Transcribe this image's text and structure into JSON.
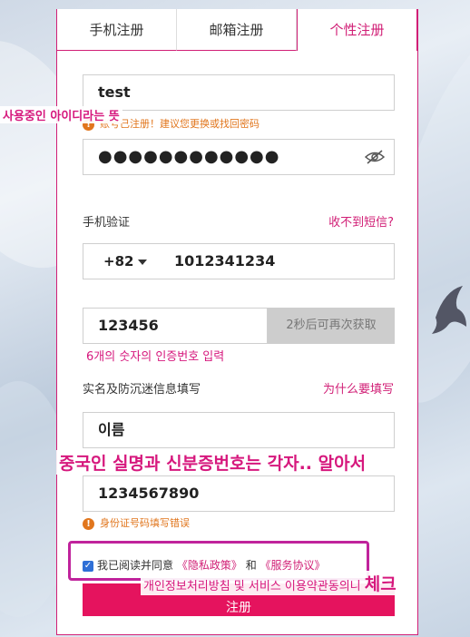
{
  "tabs": [
    {
      "label": "手机注册",
      "active": false
    },
    {
      "label": "邮箱注册",
      "active": false
    },
    {
      "label": "个性注册",
      "active": true
    }
  ],
  "form": {
    "account_value": "test",
    "account_error": "账号已注册！建议您更换或找回密码",
    "password_mask": "●●●●●●●●●●●●",
    "phone_label": "手机验证",
    "no_sms_link": "收不到短信?",
    "country_code": "+82",
    "phone_value": "1012341234",
    "code_value": "123456",
    "code_button": "2秒后可再次获取",
    "realname_label": "实名及防沉迷信息填写",
    "why_link": "为什么要填写",
    "name_value": "이름",
    "idno_value": "1234567890",
    "idno_error": "身份证号码填写错误",
    "agree_prefix": "我已阅读并同意",
    "privacy_link": "《隐私政策》",
    "and_text": "和",
    "service_link": "《服务协议》",
    "submit_label": "注册"
  },
  "annotations": {
    "id_note": "사용중인 아이디라는 뜻",
    "code_note": "6개의 숫자의 인증번호 입력",
    "realname_note": "중국인 실명과 신분증번호는 각자.. 알아서",
    "agree_note": "개인정보처리방침 및 서비스 이용약관동의니",
    "agree_note_emph": "체크"
  },
  "icons": {
    "eye": "eye-slash-icon",
    "error": "warning-icon",
    "checkbox": "checkbox-checked-icon",
    "dropdown": "caret-down-icon"
  },
  "colors": {
    "accent": "#d11f76",
    "submit": "#e5135e",
    "error": "#e1761d",
    "annotation": "#d6187d"
  }
}
